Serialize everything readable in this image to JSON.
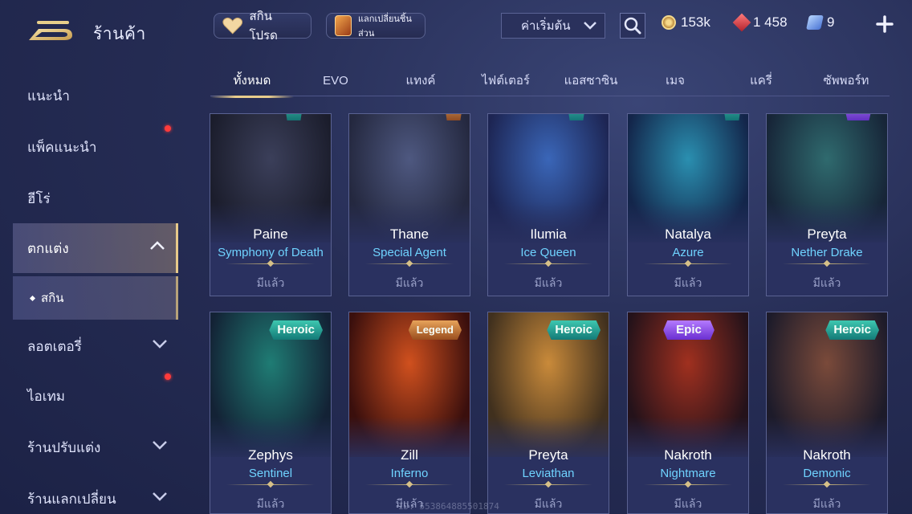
{
  "header": {
    "title": "ร้านค้า",
    "favorite_label": "สกินโปรด",
    "exchange_label": "แลกเปลี่ยนชิ้นส่วน",
    "sort": {
      "selected": "ค่าเริ่มต้น"
    },
    "currencies": [
      {
        "icon": "gold-coin-icon",
        "value": "153k"
      },
      {
        "icon": "voucher-gem-icon",
        "value": "1 458"
      },
      {
        "icon": "token-icon",
        "value": "9"
      }
    ]
  },
  "sidebar": {
    "items": [
      {
        "label": "แนะนำ",
        "badge": false
      },
      {
        "label": "แพ็คแนะนำ",
        "badge": true
      },
      {
        "label": "ฮีโร่",
        "badge": false
      },
      {
        "label": "ตกแต่ง",
        "expanded": true,
        "active": true
      },
      {
        "label": "ลอตเตอรี่",
        "expanded": false
      },
      {
        "label": "ไอเทม",
        "badge": true
      },
      {
        "label": "ร้านปรับแต่ง",
        "expanded": false
      },
      {
        "label": "ร้านแลกเปลี่ยน",
        "expanded": false
      }
    ],
    "sub_items": [
      {
        "label": "สกิน",
        "active": true
      }
    ]
  },
  "tabs": [
    {
      "label": "ทั้งหมด",
      "active": true
    },
    {
      "label": "EVO"
    },
    {
      "label": "แทงค์"
    },
    {
      "label": "ไฟต์เตอร์"
    },
    {
      "label": "แอสซาซิน"
    },
    {
      "label": "เมจ"
    },
    {
      "label": "แครี่"
    },
    {
      "label": "ซัพพอร์ท"
    }
  ],
  "cards": [
    {
      "hero": "Paine",
      "skin": "Symphony of Death",
      "status": "มีแล้ว",
      "palette": [
        "#3b3f5a",
        "#1b1d2c"
      ]
    },
    {
      "hero": "Thane",
      "skin": "Special Agent",
      "status": "มีแล้ว",
      "palette": [
        "#4e5880",
        "#24283f"
      ]
    },
    {
      "hero": "Ilumia",
      "skin": "Ice Queen",
      "status": "มีแล้ว",
      "palette": [
        "#3a66b8",
        "#1d2553"
      ]
    },
    {
      "hero": "Natalya",
      "skin": "Azure",
      "status": "มีแล้ว",
      "palette": [
        "#2a8fb0",
        "#13254a"
      ]
    },
    {
      "hero": "Preyta",
      "skin": "Nether Drake",
      "status": "มีแล้ว",
      "palette": [
        "#2f6a6e",
        "#172538"
      ]
    },
    {
      "hero": "Zephys",
      "skin": "Sentinel",
      "status": "มีแล้ว",
      "rarity": "Heroic",
      "rarity_class": "heroic",
      "palette": [
        "#1f7c74",
        "#132235"
      ]
    },
    {
      "hero": "Zill",
      "skin": "Inferno",
      "status": "มีแล้ว",
      "rarity": "Legend",
      "rarity_class": "legend",
      "palette": [
        "#d0501e",
        "#3a0f0d"
      ]
    },
    {
      "hero": "Preyta",
      "skin": "Leviathan",
      "status": "มีแล้ว",
      "rarity": "Heroic",
      "rarity_class": "heroic",
      "palette": [
        "#c98a3a",
        "#40301e"
      ]
    },
    {
      "hero": "Nakroth",
      "skin": "Nightmare",
      "status": "มีแล้ว",
      "rarity": "Epic",
      "rarity_class": "epic",
      "palette": [
        "#a0301f",
        "#24121a"
      ]
    },
    {
      "hero": "Nakroth",
      "skin": "Demonic",
      "status": "มีแล้ว",
      "rarity": "Heroic",
      "rarity_class": "heroic",
      "palette": [
        "#7a4a3a",
        "#1d1b2a"
      ]
    }
  ],
  "watermark": "ID: 553864885501874"
}
